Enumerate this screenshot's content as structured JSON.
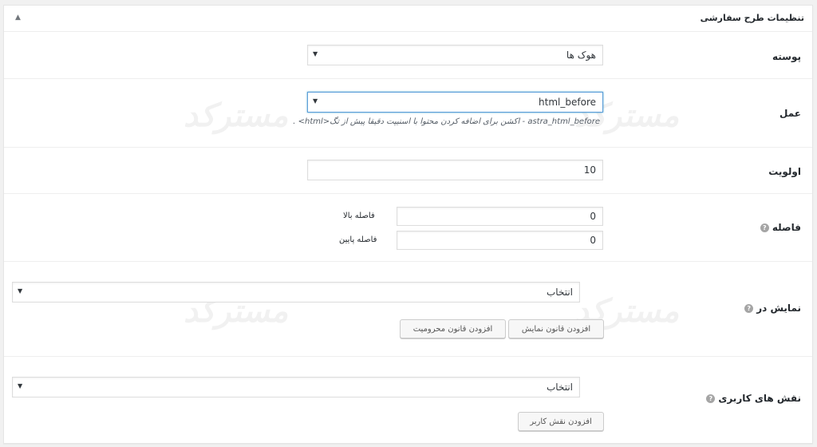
{
  "panel": {
    "title": "تنظیمات طرح سفارشی",
    "collapse_icon": "▲"
  },
  "rows": {
    "hook_type": {
      "label": "پوسته",
      "value": "هوک ها",
      "arrow": "▼"
    },
    "action": {
      "label": "عمل",
      "value": "html_before",
      "arrow": "▼",
      "description": "astra_html_before - اکشن برای اضافه کردن محتوا با اسنیپت دقیقا پیش از تگ<html> ."
    },
    "priority": {
      "label": "اولویت",
      "value": "10"
    },
    "spacing": {
      "label": "فاصله",
      "top_label": "فاصله بالا",
      "top_value": "0",
      "bottom_label": "فاصله پایین",
      "bottom_value": "0"
    },
    "display_on": {
      "label": "نمایش در",
      "select_value": "انتخاب",
      "arrow": "▼",
      "add_display_rule": "افزودن قانون نمایش",
      "add_exclusion_rule": "افزودن قانون محرومیت"
    },
    "user_roles": {
      "label": "نقش های کاربری",
      "select_value": "انتخاب",
      "arrow": "▼",
      "add_user_role": "افزودن نقش کاربر"
    }
  },
  "help_icon": "?",
  "watermark": "مسترکد",
  "colors": {
    "focus_border": "#5b9dd9",
    "panel_bg": "#ffffff",
    "page_bg": "#f1f1f1"
  }
}
